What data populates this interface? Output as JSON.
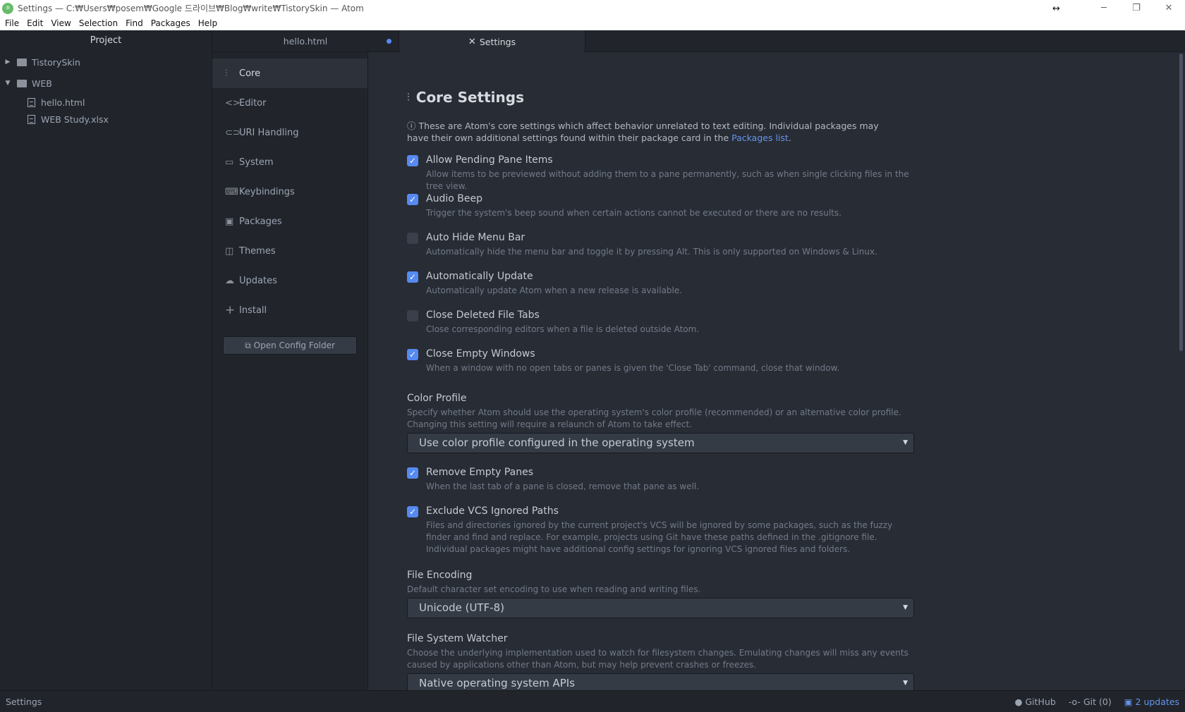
{
  "window": {
    "title": "Settings — C:₩Users₩posem₩Google 드라이브₩Blog₩write₩TistorySkin — Atom",
    "minimize_glyph": "─",
    "restore_glyph": "❐",
    "close_glyph": "✕",
    "resize_glyph": "↔"
  },
  "menu": [
    "File",
    "Edit",
    "View",
    "Selection",
    "Find",
    "Packages",
    "Help"
  ],
  "tree": {
    "header": "Project",
    "folders": [
      {
        "name": "TistorySkin",
        "expanded": false
      },
      {
        "name": "WEB",
        "expanded": true
      }
    ],
    "files": [
      "hello.html",
      "WEB Study.xlsx"
    ]
  },
  "tabs": [
    {
      "label": "hello.html",
      "modified": true,
      "active": false
    },
    {
      "label": "Settings",
      "icon": "tools-icon",
      "active": true
    }
  ],
  "settings_nav": {
    "items": [
      {
        "label": "Core",
        "icon": "sliders-icon",
        "glyph": "⫶",
        "active": true
      },
      {
        "label": "Editor",
        "icon": "code-icon",
        "glyph": "<>"
      },
      {
        "label": "URI Handling",
        "icon": "link-icon",
        "glyph": "⊂⊃"
      },
      {
        "label": "System",
        "icon": "monitor-icon",
        "glyph": "▭"
      },
      {
        "label": "Keybindings",
        "icon": "keyboard-icon",
        "glyph": "⌨"
      },
      {
        "label": "Packages",
        "icon": "package-icon",
        "glyph": "▣"
      },
      {
        "label": "Themes",
        "icon": "paintcan-icon",
        "glyph": "◫"
      },
      {
        "label": "Updates",
        "icon": "cloud-download-icon",
        "glyph": "☁"
      },
      {
        "label": "Install",
        "icon": "plus-icon",
        "glyph": "+"
      }
    ],
    "open_config_label": "Open Config Folder",
    "open_config_glyph": "⧉"
  },
  "core": {
    "title": "Core Settings",
    "title_glyph": "⫶",
    "intro_glyph": "ⓘ",
    "intro_text": "These are Atom's core settings which affect behavior unrelated to text editing. Individual packages may have their own additional settings found within their package card in the ",
    "intro_link": "Packages list",
    "intro_end": ".",
    "checkboxes": [
      {
        "title": "Allow Pending Pane Items",
        "desc": "Allow items to be previewed without adding them to a pane permanently, such as when single clicking files in the tree view.",
        "checked": true
      },
      {
        "title": "Audio Beep",
        "desc": "Trigger the system's beep sound when certain actions cannot be executed or there are no results.",
        "checked": true
      },
      {
        "title": "Auto Hide Menu Bar",
        "desc": "Automatically hide the menu bar and toggle it by pressing Alt. This is only supported on Windows & Linux.",
        "checked": false
      },
      {
        "title": "Automatically Update",
        "desc": "Automatically update Atom when a new release is available.",
        "checked": true
      },
      {
        "title": "Close Deleted File Tabs",
        "desc": "Close corresponding editors when a file is deleted outside Atom.",
        "checked": false
      },
      {
        "title": "Close Empty Windows",
        "desc": "When a window with no open tabs or panes is given the 'Close Tab' command, close that window.",
        "checked": true
      }
    ],
    "color_profile": {
      "title": "Color Profile",
      "desc": "Specify whether Atom should use the operating system's color profile (recommended) or an alternative color profile. Changing this setting will require a relaunch of Atom to take effect.",
      "value": "Use color profile configured in the operating system"
    },
    "checkboxes2": [
      {
        "title": "Remove Empty Panes",
        "desc": "When the last tab of a pane is closed, remove that pane as well.",
        "checked": true
      },
      {
        "title": "Exclude VCS Ignored Paths",
        "desc": "Files and directories ignored by the current project's VCS will be ignored by some packages, such as the fuzzy finder and find and replace. For example, projects using Git have these paths defined in the .gitignore file. Individual packages might have additional config settings for ignoring VCS ignored files and folders.",
        "checked": true
      }
    ],
    "file_encoding": {
      "title": "File Encoding",
      "desc": "Default character set encoding to use when reading and writing files.",
      "value": "Unicode (UTF-8)"
    },
    "fs_watcher": {
      "title": "File System Watcher",
      "desc": "Choose the underlying implementation used to watch for filesystem changes. Emulating changes will miss any events caused by applications other than Atom, but may help prevent crashes or freezes.",
      "value": "Native operating system APIs"
    },
    "caret_glyph": "▼",
    "check_glyph": "✓"
  },
  "status": {
    "left": "Settings",
    "github": "GitHub",
    "git": "Git (0)",
    "updates": "2 updates"
  },
  "colors": {
    "accent": "#568af2",
    "link": "#6494ed",
    "bg": "#282c34",
    "panel_bg": "#21252b"
  }
}
